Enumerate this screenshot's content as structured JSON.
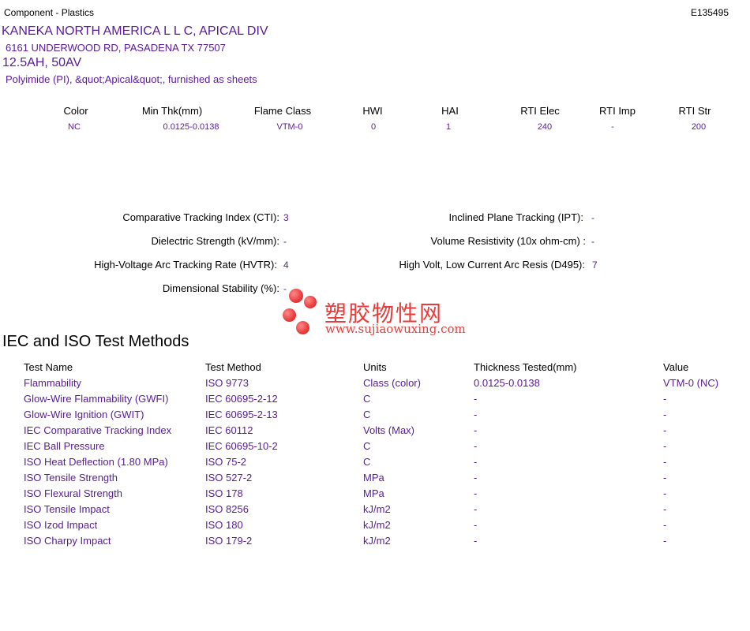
{
  "header": {
    "doc_type": "Component - Plastics",
    "file_number": "E135495",
    "company": "KANEKA NORTH AMERICA L L C, APICAL DIV",
    "address": "6161 UNDERWOOD RD, PASADENA TX   77507",
    "rating": "12.5AH, 50AV",
    "description": "Polyimide (PI), &quot;Apical&quot;, furnished as sheets"
  },
  "properties": {
    "headers": [
      "Color",
      "Min Thk(mm)",
      "Flame Class",
      "HWI",
      "HAI",
      "RTI Elec",
      "RTI Imp",
      "RTI Str"
    ],
    "values": [
      "NC",
      "0.0125-0.0138",
      "VTM-0",
      "0",
      "1",
      "240",
      "-",
      "200"
    ]
  },
  "electrical": {
    "cti_label": "Comparative Tracking Index (CTI):",
    "cti_value": "3",
    "ipt_label": "Inclined Plane Tracking (IPT):",
    "ipt_value": "-",
    "ds_label": "Dielectric Strength (kV/mm):",
    "ds_value": "-",
    "vr_label": "Volume Resistivity (10x ohm-cm) :",
    "vr_value": "-",
    "hvtr_label": "High-Voltage Arc Tracking Rate (HVTR):",
    "hvtr_value": "4",
    "d495_label": "High Volt, Low Current Arc Resis (D495):",
    "d495_value": "7",
    "dim_label": "Dimensional Stability (%):",
    "dim_value": "-"
  },
  "watermark": {
    "cn": "塑胶物性网",
    "url": "www.sujiaowuxing.com"
  },
  "iec": {
    "title": "IEC and ISO Test Methods",
    "headers": [
      "Test Name",
      "Test Method",
      "Units",
      "Thickness Tested(mm)",
      "Value"
    ],
    "rows": [
      [
        "Flammability",
        "ISO 9773",
        "Class (color)",
        "0.0125-0.0138",
        "VTM-0 (NC)"
      ],
      [
        "Glow-Wire Flammability (GWFI)",
        "IEC 60695-2-12",
        "C",
        "-",
        "-"
      ],
      [
        "Glow-Wire Ignition (GWIT)",
        "IEC 60695-2-13",
        "C",
        "-",
        "-"
      ],
      [
        "IEC Comparative Tracking Index",
        "IEC 60112",
        "Volts (Max)",
        "-",
        "-"
      ],
      [
        "IEC Ball Pressure",
        "IEC 60695-10-2",
        "C",
        "-",
        "-"
      ],
      [
        "ISO Heat Deflection (1.80 MPa)",
        "ISO 75-2",
        "C",
        "-",
        "-"
      ],
      [
        "ISO Tensile Strength",
        "ISO 527-2",
        "MPa",
        "-",
        "-"
      ],
      [
        "ISO Flexural Strength",
        "ISO 178",
        "MPa",
        "-",
        "-"
      ],
      [
        "ISO Tensile Impact",
        "ISO 8256",
        "kJ/m2",
        "-",
        "-"
      ],
      [
        "ISO Izod Impact",
        "ISO 180",
        "kJ/m2",
        "-",
        "-"
      ],
      [
        "ISO Charpy Impact",
        "ISO 179-2",
        "kJ/m2",
        "-",
        "-"
      ]
    ]
  }
}
